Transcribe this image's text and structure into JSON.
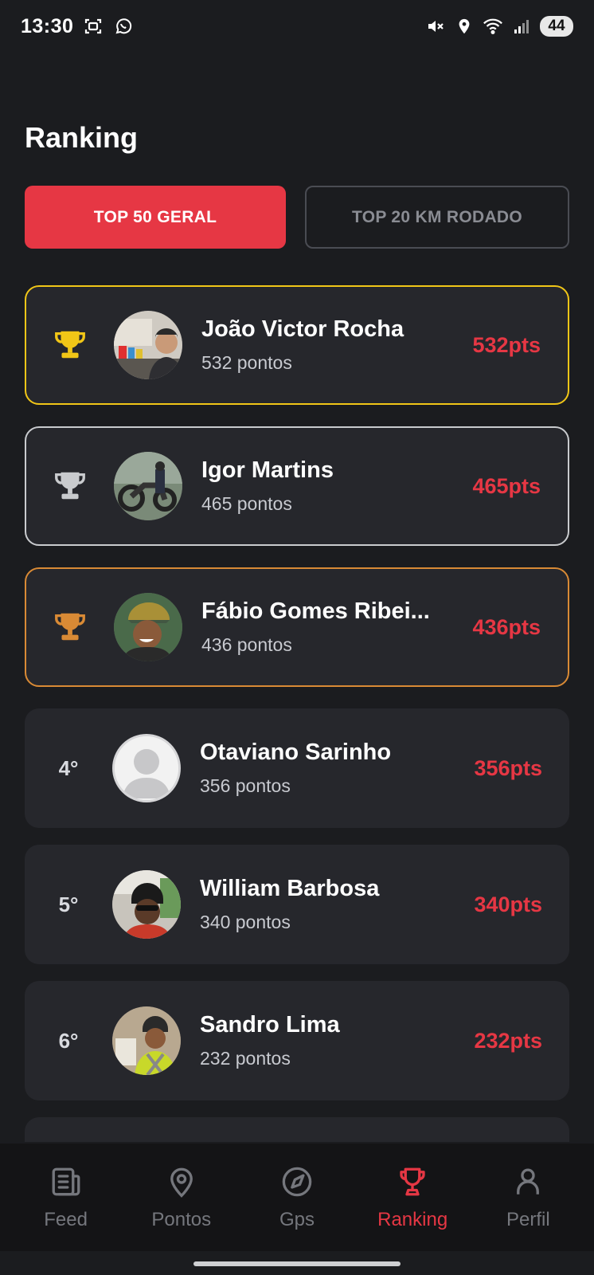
{
  "status_bar": {
    "time": "13:30",
    "battery": "44",
    "icons": [
      "screenshot-icon",
      "whatsapp-icon",
      "mute-icon",
      "location-icon",
      "wifi-icon",
      "signal-icon"
    ]
  },
  "page": {
    "title": "Ranking"
  },
  "tabs": [
    {
      "label": "TOP 50 GERAL",
      "active": true
    },
    {
      "label": "TOP 20 KM RODADO",
      "active": false
    }
  ],
  "ranking": [
    {
      "rank": "1",
      "name": "João Victor Rocha",
      "points_text": "532 pontos",
      "pts": "532pts",
      "medal": "gold",
      "medal_color": "#f1c617"
    },
    {
      "rank": "2",
      "name": "Igor Martins",
      "points_text": "465 pontos",
      "pts": "465pts",
      "medal": "silver",
      "medal_color": "#c9cbce"
    },
    {
      "rank": "3",
      "name": "Fábio Gomes Ribei...",
      "points_text": "436 pontos",
      "pts": "436pts",
      "medal": "bronze",
      "medal_color": "#d98a35"
    },
    {
      "rank": "4°",
      "name": "Otaviano Sarinho",
      "points_text": "356 pontos",
      "pts": "356pts"
    },
    {
      "rank": "5°",
      "name": "William Barbosa",
      "points_text": "340 pontos",
      "pts": "340pts"
    },
    {
      "rank": "6°",
      "name": "Sandro Lima",
      "points_text": "232 pontos",
      "pts": "232pts"
    }
  ],
  "nav": [
    {
      "label": "Feed",
      "icon": "feed-icon",
      "active": false
    },
    {
      "label": "Pontos",
      "icon": "map-pin-icon",
      "active": false
    },
    {
      "label": "Gps",
      "icon": "navigation-icon",
      "active": false
    },
    {
      "label": "Ranking",
      "icon": "trophy-icon",
      "active": true
    },
    {
      "label": "Perfil",
      "icon": "user-icon",
      "active": false
    }
  ],
  "colors": {
    "accent": "#e63744",
    "background": "#1b1c1f",
    "card": "#26272c",
    "gold": "#f1c617",
    "silver": "#c9cbce",
    "bronze": "#d98a35"
  }
}
